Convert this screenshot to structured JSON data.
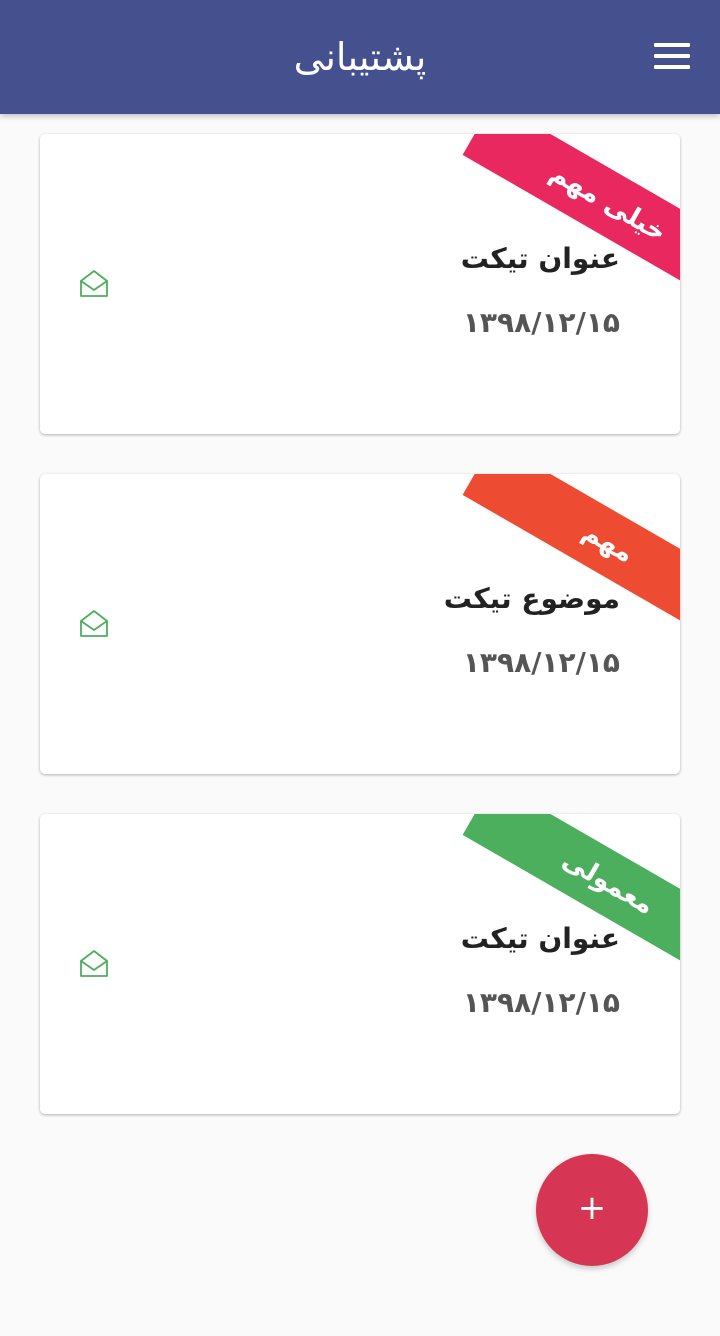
{
  "header": {
    "title": "پشتیبانی",
    "menu_icon": "hamburger-menu-icon",
    "background": "#45508f"
  },
  "tickets": [
    {
      "priority": "خیلی مهم",
      "priority_color": "#e8285e",
      "title": "عنوان تیکت",
      "date": "۱۳۹۸/۱۲/۱۵",
      "icon": "open-envelope-icon"
    },
    {
      "priority": "مهم",
      "priority_color": "#ee4b33",
      "title": "موضوع تیکت",
      "date": "۱۳۹۸/۱۲/۱۵",
      "icon": "open-envelope-icon"
    },
    {
      "priority": "معمولی",
      "priority_color": "#4caf5d",
      "title": "عنوان تیکت",
      "date": "۱۳۹۸/۱۲/۱۵",
      "icon": "open-envelope-icon"
    }
  ],
  "icon_color": "#4caf5d",
  "fab": {
    "label": "+",
    "icon": "plus-icon",
    "color": "#d63653"
  }
}
